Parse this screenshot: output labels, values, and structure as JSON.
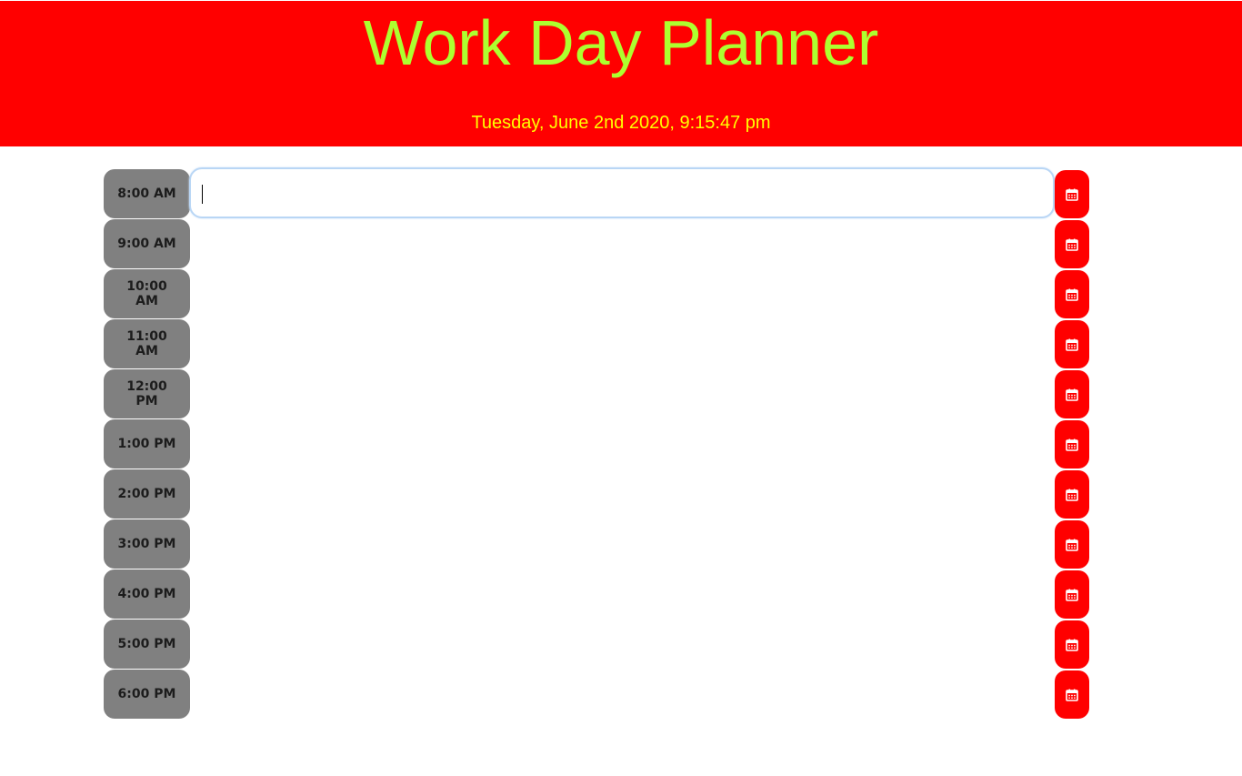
{
  "header": {
    "title": "Work Day Planner",
    "current_datetime": "Tuesday, June 2nd 2020, 9:15:47 pm"
  },
  "colors": {
    "header_background": "#ff0000",
    "title_text": "#adff2f",
    "date_text": "#ffff00",
    "hour_block": "#808080",
    "save_button": "#ff0000",
    "focus_ring": "#b9d6f5"
  },
  "save_icon": "calendar-icon",
  "time_blocks": [
    {
      "hour": "8:00 AM",
      "text": ""
    },
    {
      "hour": "9:00 AM",
      "text": ""
    },
    {
      "hour": "10:00 AM",
      "text": ""
    },
    {
      "hour": "11:00 AM",
      "text": ""
    },
    {
      "hour": "12:00 PM",
      "text": ""
    },
    {
      "hour": "1:00 PM",
      "text": ""
    },
    {
      "hour": "2:00 PM",
      "text": ""
    },
    {
      "hour": "3:00 PM",
      "text": ""
    },
    {
      "hour": "4:00 PM",
      "text": ""
    },
    {
      "hour": "5:00 PM",
      "text": ""
    },
    {
      "hour": "6:00 PM",
      "text": ""
    }
  ]
}
